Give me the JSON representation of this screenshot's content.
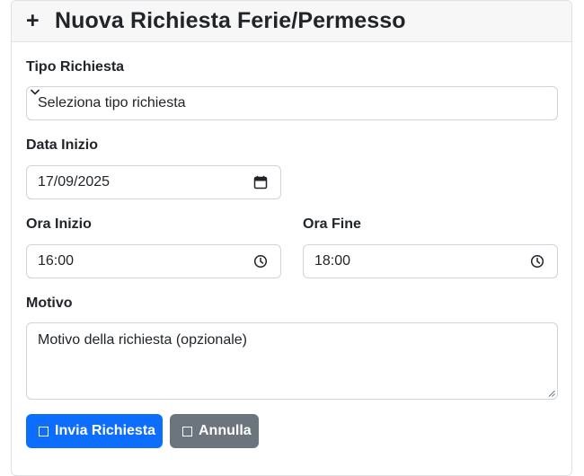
{
  "header": {
    "icon": "plus-icon",
    "title": "Nuova Richiesta Ferie/Permesso"
  },
  "form": {
    "tipo": {
      "label": "Tipo Richiesta",
      "value": "Seleziona tipo richiesta"
    },
    "data_inizio": {
      "label": "Data Inizio",
      "value": "17/09/2025"
    },
    "ora_inizio": {
      "label": "Ora Inizio",
      "value": "16:00"
    },
    "ora_fine": {
      "label": "Ora Fine",
      "value": "18:00"
    },
    "motivo": {
      "label": "Motivo",
      "placeholder": "Motivo della richiesta (opzionale)"
    }
  },
  "actions": {
    "submit_label": "Invia Richiesta",
    "cancel_label": "Annulla"
  },
  "colors": {
    "primary": "#0d6efd",
    "secondary": "#6c757d",
    "header_bg": "#f7f7f7",
    "border": "#ced4da"
  }
}
